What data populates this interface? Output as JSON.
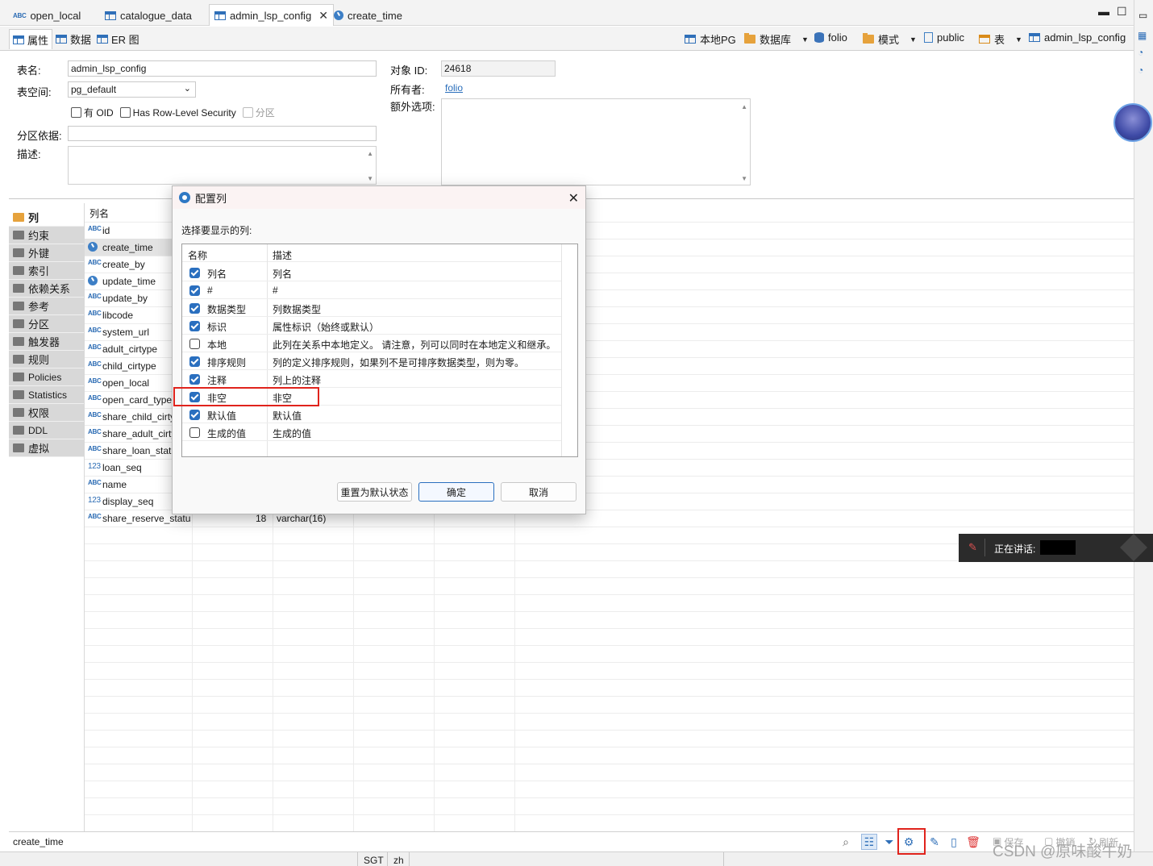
{
  "editor_tabs": [
    {
      "label": "open_local",
      "icon": "abc-column-icon"
    },
    {
      "label": "catalogue_data",
      "icon": "table-icon"
    },
    {
      "label": "admin_lsp_config",
      "icon": "table-icon",
      "active": true
    },
    {
      "label": "create_time",
      "icon": "clock-icon"
    }
  ],
  "sub_tabs": [
    {
      "label": "属性",
      "active": true
    },
    {
      "label": "数据"
    },
    {
      "label": "ER 图"
    }
  ],
  "toolbar_path": {
    "connection": "本地PG",
    "database": "数据库",
    "db_name": "folio",
    "schema_label": "模式",
    "schema_name": "public",
    "table_label": "表",
    "table_name": "admin_lsp_config"
  },
  "properties": {
    "table_name_label": "表名:",
    "table_name_value": "admin_lsp_config",
    "tablespace_label": "表空间:",
    "tablespace_value": "pg_default",
    "has_oid_label": "有 OID",
    "row_level_security_label": "Has Row-Level Security",
    "partition_check_label": "分区",
    "partition_by_label": "分区依据:",
    "description_label": "描述:",
    "object_id_label": "对象 ID:",
    "object_id_value": "24618",
    "owner_label": "所有者:",
    "owner_value": "folio",
    "extra_options_label": "额外选项:"
  },
  "categories": [
    "列",
    "约束",
    "外键",
    "索引",
    "依赖关系",
    "参考",
    "分区",
    "触发器",
    "规则",
    "Policies",
    "Statistics",
    "权限",
    "DDL",
    "虚拟"
  ],
  "columns_grid": {
    "header": "列名",
    "rows": [
      {
        "name": "id",
        "type_icon": "abc"
      },
      {
        "name": "create_time",
        "type_icon": "clock",
        "selected": true
      },
      {
        "name": "create_by",
        "type_icon": "abc"
      },
      {
        "name": "update_time",
        "type_icon": "clock"
      },
      {
        "name": "update_by",
        "type_icon": "abc"
      },
      {
        "name": "libcode",
        "type_icon": "abc"
      },
      {
        "name": "system_url",
        "type_icon": "abc"
      },
      {
        "name": "adult_cirtype",
        "type_icon": "abc"
      },
      {
        "name": "child_cirtype",
        "type_icon": "abc"
      },
      {
        "name": "open_local",
        "type_icon": "abc"
      },
      {
        "name": "open_card_type",
        "type_icon": "abc"
      },
      {
        "name": "share_child_cirty",
        "type_icon": "abc"
      },
      {
        "name": "share_adult_cirty",
        "type_icon": "abc"
      },
      {
        "name": "share_loan_statu",
        "type_icon": "abc"
      },
      {
        "name": "loan_seq",
        "type_icon": "123"
      },
      {
        "name": "name",
        "type_icon": "abc"
      },
      {
        "name": "display_seq",
        "type_icon": "123"
      },
      {
        "name": "share_reserve_status",
        "type_icon": "abc",
        "num": "18",
        "type": "varchar(16)"
      }
    ]
  },
  "dialog": {
    "title": "配置列",
    "prompt": "选择要显示的列:",
    "col_name_header": "名称",
    "col_desc_header": "描述",
    "rows": [
      {
        "name": "列名",
        "desc": "列名",
        "checked": true
      },
      {
        "name": "#",
        "desc": "#",
        "checked": true
      },
      {
        "name": "数据类型",
        "desc": "列数据类型",
        "checked": true
      },
      {
        "name": "标识",
        "desc": "属性标识（始终或默认）",
        "checked": true
      },
      {
        "name": "本地",
        "desc": "此列在关系中本地定义。 请注意，列可以同时在本地定义和继承。",
        "checked": false
      },
      {
        "name": "排序规则",
        "desc": "列的定义排序规则，如果列不是可排序数据类型，则为零。",
        "checked": true
      },
      {
        "name": "注释",
        "desc": "列上的注释",
        "checked": true
      },
      {
        "name": "非空",
        "desc": "非空",
        "checked": true,
        "highlighted": true
      },
      {
        "name": "默认值",
        "desc": "默认值",
        "checked": true
      },
      {
        "name": "生成的值",
        "desc": "生成的值",
        "checked": false
      }
    ],
    "reset_button": "重置为默认状态",
    "ok_button": "确定",
    "cancel_button": "取消"
  },
  "status": {
    "selected_column": "create_time",
    "save_label": "保存",
    "revert_label": "撤销",
    "refresh_label": "刷新",
    "timezone": "SGT",
    "locale": "zh"
  },
  "voice_overlay": {
    "label": "正在讲话:"
  },
  "watermark": "CSDN @原味酸牛奶",
  "colors": {
    "accent": "#2a6fbf",
    "highlight_box": "#e0231c",
    "folder": "#e6a23c"
  }
}
